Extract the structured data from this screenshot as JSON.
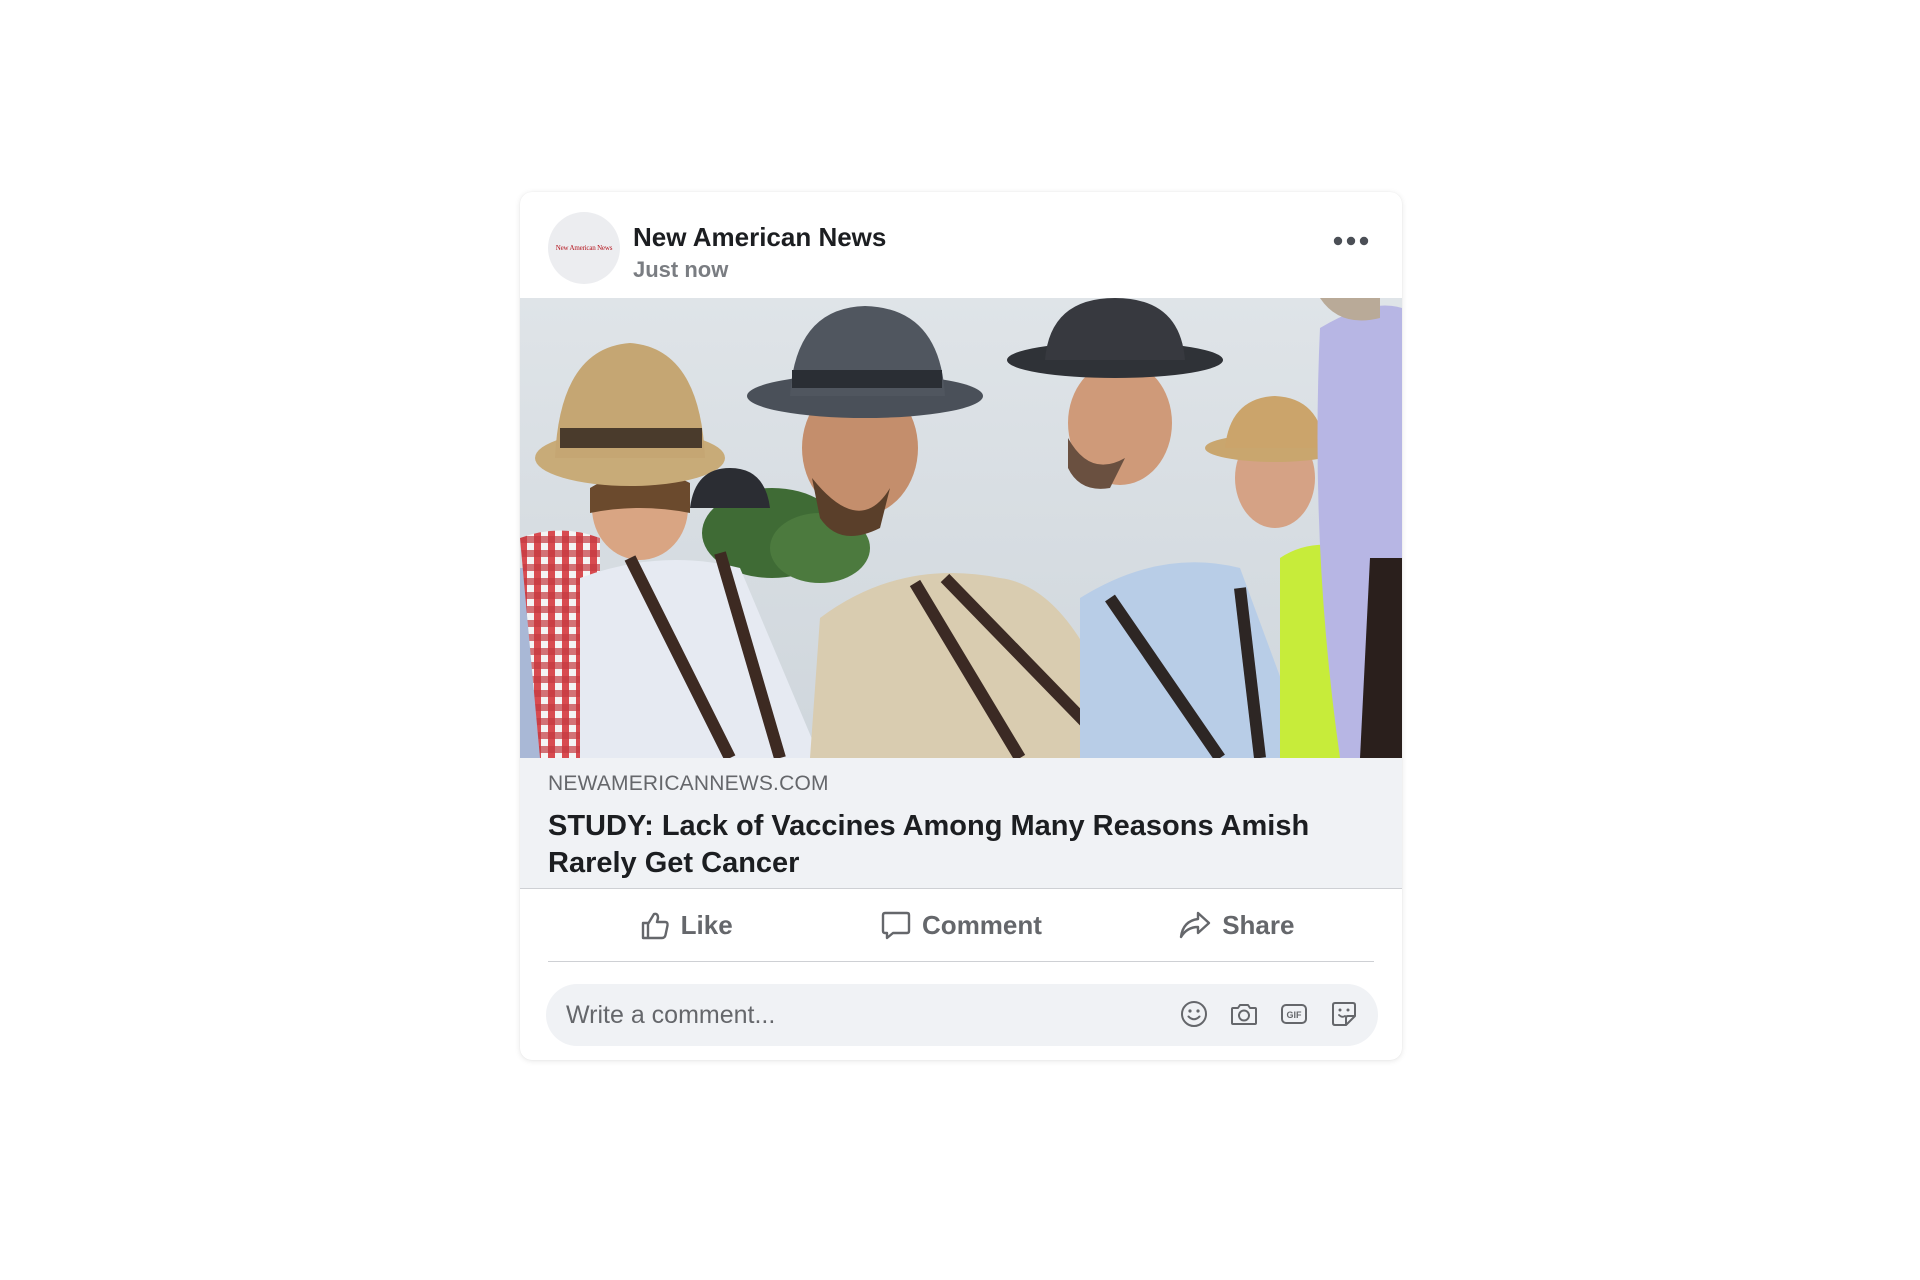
{
  "post": {
    "page_name": "New American News",
    "avatar_logo_text": "New American News",
    "time": "Just now",
    "more_icon": "more-options-icon"
  },
  "link": {
    "domain": "NEWAMERICANNEWS.COM",
    "title": "STUDY: Lack of Vaccines Among Many Reasons Amish Rarely Get Cancer"
  },
  "actions": {
    "like_label": "Like",
    "comment_label": "Comment",
    "share_label": "Share"
  },
  "comment": {
    "placeholder": "Write a comment...",
    "icons": [
      "emoji-icon",
      "camera-icon",
      "gif-icon",
      "sticker-icon"
    ]
  },
  "colors": {
    "text_primary": "#1c1e21",
    "text_secondary": "#65676b",
    "preview_bg": "#f0f2f5",
    "divider": "#ced0d4"
  }
}
